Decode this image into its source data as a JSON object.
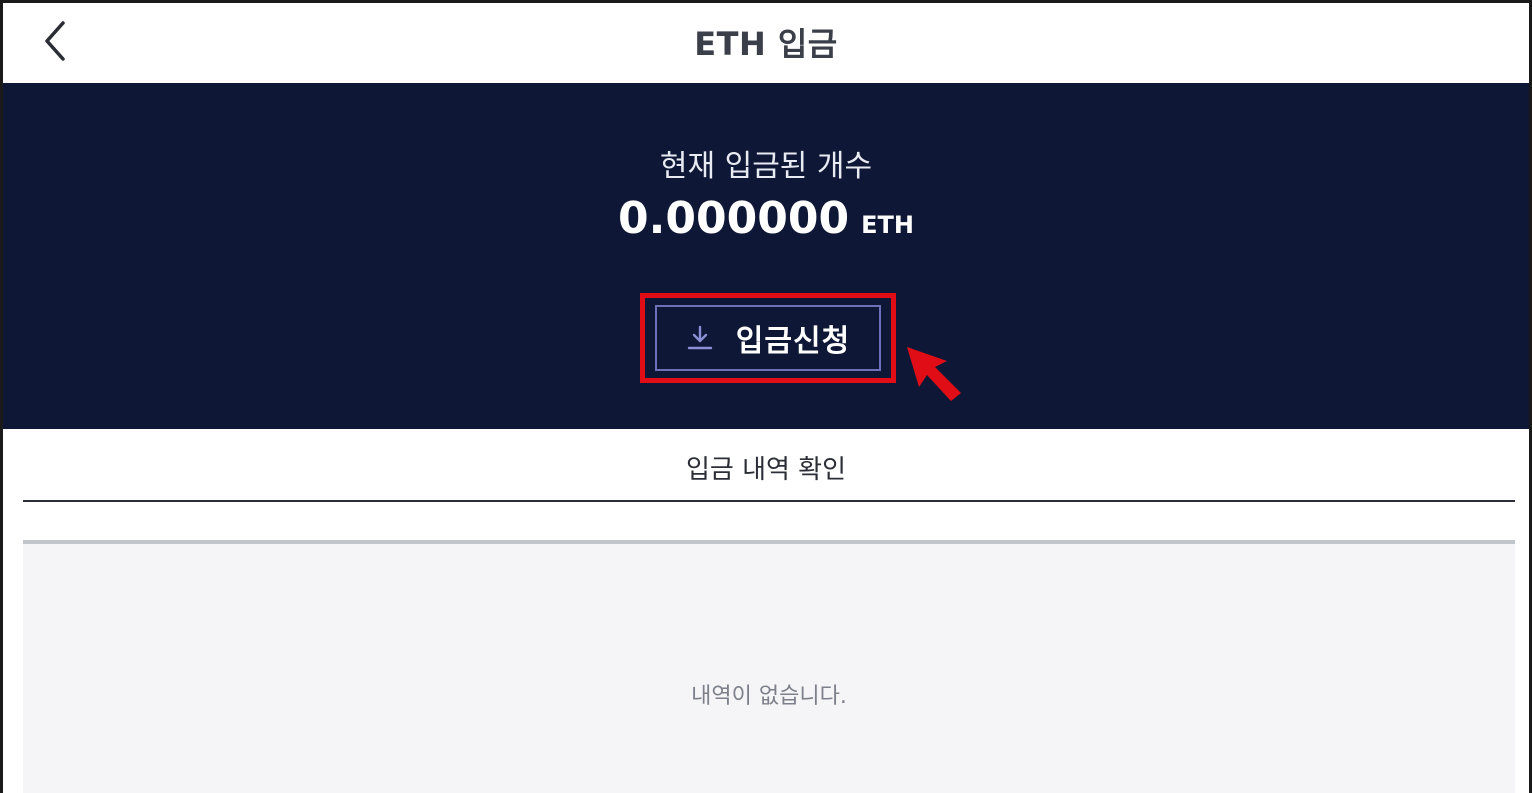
{
  "header": {
    "title": "ETH 입금",
    "back_icon": "chevron-left-icon"
  },
  "summary": {
    "label": "현재 입금된 개수",
    "amount": "0.000000",
    "unit": "ETH"
  },
  "deposit_button": {
    "label": "입금신청",
    "icon": "download-icon"
  },
  "history": {
    "title": "입금 내역 확인",
    "empty_message": "내역이 없습니다."
  },
  "colors": {
    "hero_background": "#0e1736",
    "button_border": "#6d72b8",
    "highlight": "#e10d16",
    "panel_background": "#f5f5f7"
  }
}
